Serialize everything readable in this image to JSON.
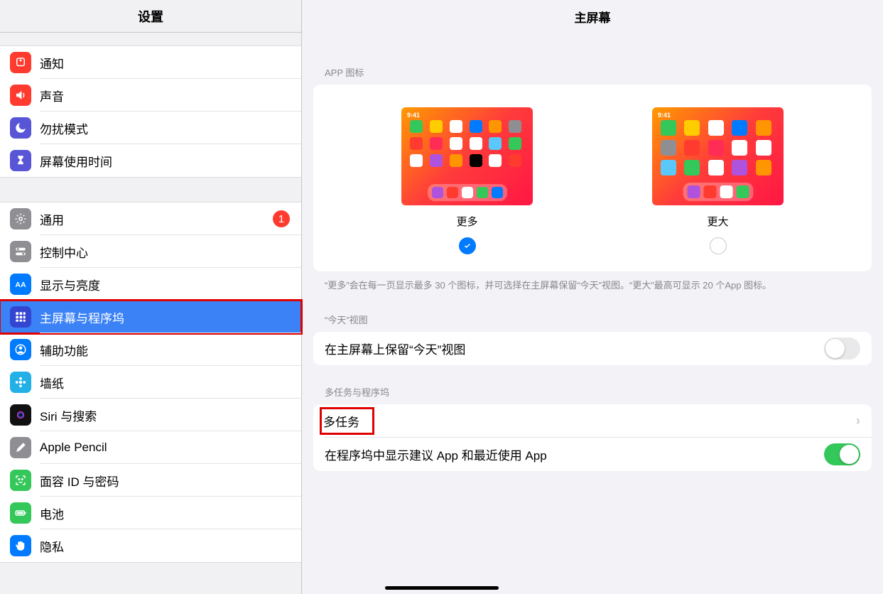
{
  "sidebar": {
    "title": "设置",
    "groups": [
      [
        {
          "id": "notifications",
          "label": "通知",
          "icon": "bell",
          "color": "#ff3b30",
          "frame": "square"
        },
        {
          "id": "sound",
          "label": "声音",
          "icon": "speaker",
          "color": "#ff3b30"
        },
        {
          "id": "dnd",
          "label": "勿扰模式",
          "icon": "moon",
          "color": "#5856d6"
        },
        {
          "id": "screentime",
          "label": "屏幕使用时间",
          "icon": "hourglass",
          "color": "#5856d6"
        }
      ],
      [
        {
          "id": "general",
          "label": "通用",
          "icon": "gear",
          "color": "#8e8e93",
          "badge": "1"
        },
        {
          "id": "control",
          "label": "控制中心",
          "icon": "switches",
          "color": "#8e8e93"
        },
        {
          "id": "display",
          "label": "显示与亮度",
          "icon": "aa",
          "color": "#007aff"
        },
        {
          "id": "home",
          "label": "主屏幕与程序坞",
          "icon": "grid",
          "color": "#3445d1",
          "selected": true,
          "redframe": true
        },
        {
          "id": "accessibility",
          "label": "辅助功能",
          "icon": "person",
          "color": "#007aff"
        },
        {
          "id": "wallpaper",
          "label": "墙纸",
          "icon": "flower",
          "color": "#22b0e7"
        },
        {
          "id": "siri",
          "label": "Siri 与搜索",
          "icon": "siri",
          "color": "#111"
        },
        {
          "id": "pencil",
          "label": "Apple Pencil",
          "icon": "pencil",
          "color": "#8e8e93"
        },
        {
          "id": "faceid",
          "label": "面容 ID 与密码",
          "icon": "face",
          "color": "#34c759"
        },
        {
          "id": "battery",
          "label": "电池",
          "icon": "battery",
          "color": "#34c759"
        },
        {
          "id": "privacy",
          "label": "隐私",
          "icon": "hand",
          "color": "#007aff"
        }
      ]
    ]
  },
  "detail": {
    "title": "主屏幕",
    "appIcons": {
      "sectionLabel": "APP 图标",
      "options": [
        {
          "id": "more",
          "label": "更多",
          "checked": true
        },
        {
          "id": "bigger",
          "label": "更大",
          "checked": false
        }
      ],
      "footnote": "“更多”会在每一页显示最多 30 个图标，并可选择在主屏幕保留“今天”视图。“更大”最高可显示 20 个App 图标。",
      "previewTime": "9:41"
    },
    "today": {
      "sectionLabel": "“今天”视图",
      "rowLabel": "在主屏幕上保留“今天”视图",
      "switch": false
    },
    "multitask": {
      "sectionLabel": "多任务与程序坞",
      "rows": [
        {
          "id": "multitask",
          "label": "多任务",
          "nav": true,
          "redframe": true
        },
        {
          "id": "dock",
          "label": "在程序坞中显示建议 App 和最近使用 App",
          "switch": true
        }
      ]
    }
  }
}
